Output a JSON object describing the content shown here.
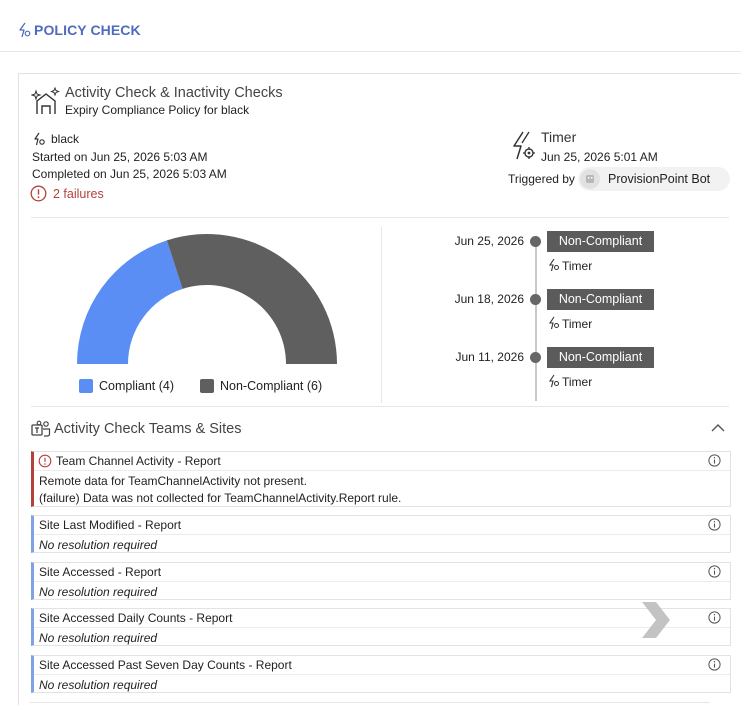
{
  "header": {
    "title": "POLICY CHECK",
    "icon": "policy-icon"
  },
  "activity": {
    "title": "Activity Check & Inactivity Checks",
    "subtitle": "Expiry Compliance Policy for black",
    "workspace": "black",
    "started": "Started on Jun 25, 2026 5:03 AM",
    "completed": "Completed on Jun 25, 2026 5:03 AM",
    "failures": "2 failures",
    "failure_color": "#b3423a"
  },
  "trigger": {
    "title": "Timer",
    "date": "Jun 25, 2026 5:01 AM",
    "triggered_label": "Triggered by",
    "bot_name": "ProvisionPoint Bot"
  },
  "chart_data": {
    "type": "pie",
    "subtype": "semi-donut",
    "categories": [
      "Compliant",
      "Non-Compliant"
    ],
    "values": [
      4,
      6
    ],
    "colors": [
      "#5b8ef5",
      "#5f5f5f"
    ],
    "legend": [
      "Compliant (4)",
      "Non-Compliant (6)"
    ],
    "legend_position": "bottom"
  },
  "timeline": [
    {
      "date": "Jun 25, 2026",
      "status": "Non-Compliant",
      "source": "Timer"
    },
    {
      "date": "Jun 18, 2026",
      "status": "Non-Compliant",
      "source": "Timer"
    },
    {
      "date": "Jun 11, 2026",
      "status": "Non-Compliant",
      "source": "Timer"
    }
  ],
  "section": {
    "title": "Activity Check Teams & Sites",
    "expanded": true
  },
  "reports": [
    {
      "title": "Team Channel Activity - Report",
      "status": "failed",
      "lines": [
        "Remote data for TeamChannelActivity not present.",
        "(failure) Data was not collected for TeamChannelActivity.Report rule."
      ]
    },
    {
      "title": "Site Last Modified - Report",
      "status": "ok",
      "lines": [
        "No resolution required"
      ]
    },
    {
      "title": "Site Accessed - Report",
      "status": "ok",
      "lines": [
        "No resolution required"
      ]
    },
    {
      "title": "Site Accessed Daily Counts - Report",
      "status": "ok",
      "lines": [
        "No resolution required"
      ]
    },
    {
      "title": "Site Accessed Past Seven Day Counts - Report",
      "status": "ok",
      "lines": [
        "No resolution required"
      ]
    }
  ],
  "colors": {
    "accent": "#4f6bbd",
    "compliant": "#5b8ef5",
    "noncompliant": "#5f5f5f",
    "badge": "#5b5b5b"
  }
}
